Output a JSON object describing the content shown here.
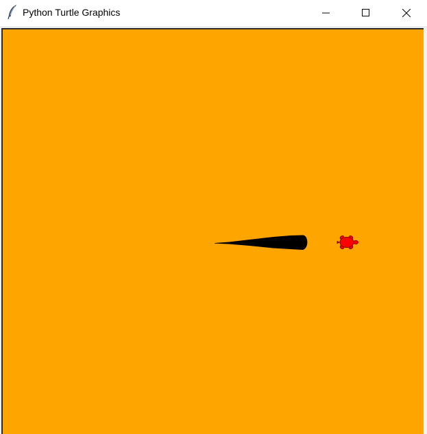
{
  "window": {
    "title": "Python Turtle Graphics",
    "icons": {
      "app": "feather-icon",
      "minimize": "minimize-icon",
      "maximize": "maximize-icon",
      "close": "close-icon"
    }
  },
  "canvas": {
    "background_color": "#ffa500",
    "stroke_color": "#000000",
    "turtle_color": "#ff0000",
    "turtle_outline_color": "#8b0000",
    "turtle_shape": "turtle"
  }
}
